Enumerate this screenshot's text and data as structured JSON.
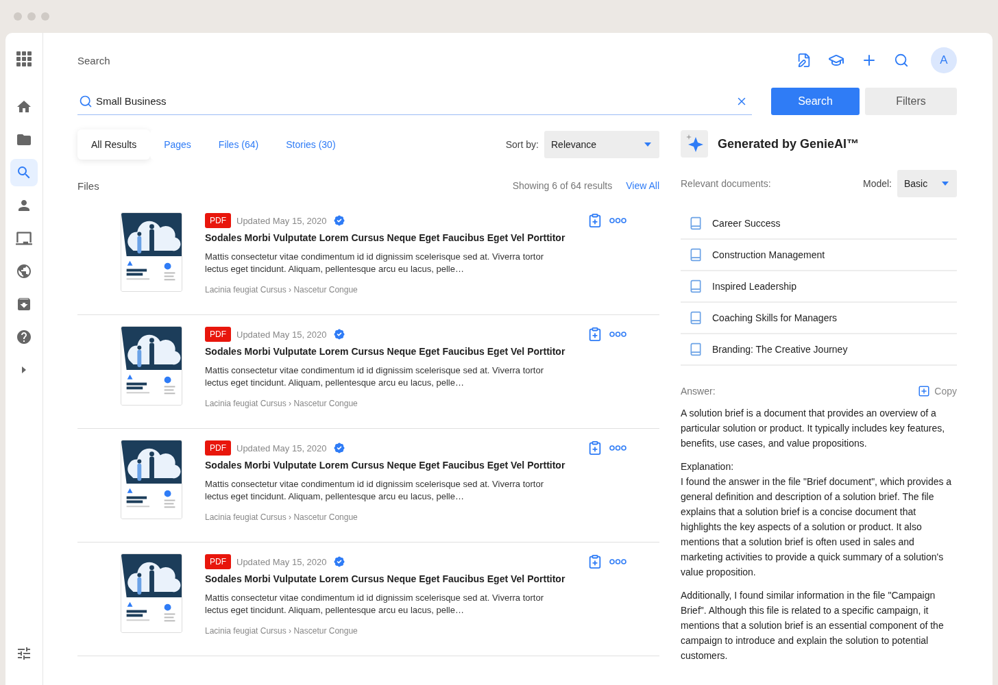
{
  "sidebar": {
    "items": [
      {
        "selected": false
      },
      {
        "selected": false
      },
      {
        "selected": true
      },
      {
        "selected": false
      },
      {
        "selected": false
      },
      {
        "selected": false
      },
      {
        "selected": false
      },
      {
        "selected": false
      }
    ]
  },
  "header": {
    "title": "Search",
    "avatar": "A"
  },
  "search": {
    "value": "Small Business",
    "button": "Search",
    "filters": "Filters"
  },
  "tabs": [
    {
      "label": "All Results",
      "selected": true
    },
    {
      "label": "Pages",
      "selected": false
    },
    {
      "label": "Files (64)",
      "selected": false
    },
    {
      "label": "Stories (30)",
      "selected": false
    }
  ],
  "sort": {
    "label": "Sort by:",
    "value": "Relevance"
  },
  "files": {
    "title": "Files",
    "showing": "Showing 6 of 64 results",
    "view_all": "View All",
    "results": [
      {
        "badge": "PDF",
        "updated": "Updated May 15, 2020",
        "verified": true,
        "title": "Sodales Morbi Vulputate Lorem Cursus Neque Eget Faucibus Eget Vel Porttitor",
        "description": "Mattis consectetur vitae condimentum id id dignissim scelerisque sed at. Viverra tortor lectus eget tincidunt. Aliquam, pellentesque arcu eu lacus, pelle…",
        "path": "Lacinia feugiat Cursus › Nascetur Congue"
      },
      {
        "badge": "PDF",
        "updated": "Updated May 15, 2020",
        "verified": true,
        "title": "Sodales Morbi Vulputate Lorem Cursus Neque Eget Faucibus Eget Vel Porttitor",
        "description": "Mattis consectetur vitae condimentum id id dignissim scelerisque sed at. Viverra tortor lectus eget tincidunt. Aliquam, pellentesque arcu eu lacus, pelle…",
        "path": "Lacinia feugiat Cursus › Nascetur Congue"
      },
      {
        "badge": "PDF",
        "updated": "Updated May 15, 2020",
        "verified": true,
        "title": "Sodales Morbi Vulputate Lorem Cursus Neque Eget Faucibus Eget Vel Porttitor",
        "description": "Mattis consectetur vitae condimentum id id dignissim scelerisque sed at. Viverra tortor lectus eget tincidunt. Aliquam, pellentesque arcu eu lacus, pelle…",
        "path": "Lacinia feugiat Cursus › Nascetur Congue"
      },
      {
        "badge": "PDF",
        "updated": "Updated May 15, 2020",
        "verified": true,
        "title": "Sodales Morbi Vulputate Lorem Cursus Neque Eget Faucibus Eget Vel Porttitor",
        "description": "Mattis consectetur vitae condimentum id id dignissim scelerisque sed at. Viverra tortor lectus eget tincidunt. Aliquam, pellentesque arcu eu lacus, pelle…",
        "path": "Lacinia feugiat Cursus › Nascetur Congue"
      }
    ]
  },
  "genie": {
    "title": "Generated by GenieAI™",
    "relevant_label": "Relevant documents:",
    "model_label": "Model:",
    "model": "Basic",
    "documents": [
      "Career Success",
      "Construction Management",
      "Inspired Leadership",
      "Coaching Skills for Managers",
      "Branding: The Creative Journey"
    ],
    "answer_label": "Answer:",
    "copy": "Copy",
    "answer": [
      [
        "A solution brief is a document that provides an overview of a particular solution or product. It typically includes key features, benefits, use cases, and value propositions."
      ],
      [
        "Explanation:",
        "I found the answer in the file \"Brief document\", which provides a general definition and description of a solution brief. The file explains that a solution brief is a concise document that highlights the key aspects of a solution or product. It also mentions that a solution brief is often used in sales and marketing activities to provide a quick summary of a solution's value proposition."
      ],
      [
        "Additionally, I found similar information in the file \"Campaign Brief\". Although this file is related to a specific campaign, it mentions that a solution brief is an essential component of the campaign to introduce and explain the solution to potential customers."
      ]
    ]
  }
}
